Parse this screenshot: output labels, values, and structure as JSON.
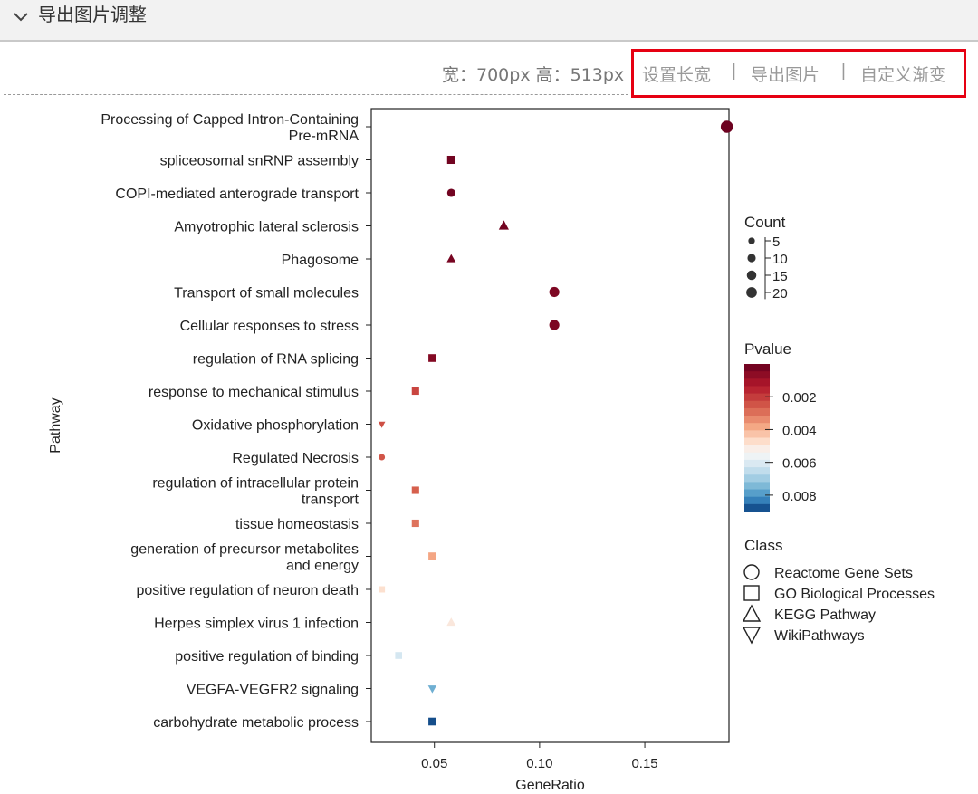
{
  "panel": {
    "title": "导出图片调整"
  },
  "size_info": {
    "text": "宽：700px 高：513px"
  },
  "toolbar": {
    "set_size": "设置长宽",
    "export": "导出图片",
    "gradient": "自定义渐变",
    "separator": "|",
    "highlight_color": "#e60012"
  },
  "chart_data": {
    "type": "scatter",
    "xlabel": "GeneRatio",
    "ylabel": "Pathway",
    "xlim": [
      0.02,
      0.19
    ],
    "xticks": [
      0.05,
      0.1,
      0.15
    ],
    "xtick_labels": [
      "0.05",
      "0.10",
      "0.15"
    ],
    "points": [
      {
        "label": "Processing of Capped Intron-Containing Pre-mRNA",
        "lines": [
          "Processing of Capped Intron-Containing",
          "Pre-mRNA"
        ],
        "x": 0.189,
        "count": 22,
        "pvalue": 0.0001,
        "class": "Reactome Gene Sets"
      },
      {
        "label": "spliceosomal snRNP assembly",
        "lines": [
          "spliceosomal snRNP assembly"
        ],
        "x": 0.058,
        "count": 7,
        "pvalue": 0.0002,
        "class": "GO Biological Processes"
      },
      {
        "label": "COPI-mediated anterograde transport",
        "lines": [
          "COPI-mediated anterograde transport"
        ],
        "x": 0.058,
        "count": 7,
        "pvalue": 0.0002,
        "class": "Reactome Gene Sets"
      },
      {
        "label": "Amyotrophic lateral sclerosis",
        "lines": [
          "Amyotrophic lateral sclerosis"
        ],
        "x": 0.083,
        "count": 10,
        "pvalue": 0.0002,
        "class": "KEGG Pathway"
      },
      {
        "label": "Phagosome",
        "lines": [
          "Phagosome"
        ],
        "x": 0.058,
        "count": 7,
        "pvalue": 0.0003,
        "class": "KEGG Pathway"
      },
      {
        "label": "Transport of small molecules",
        "lines": [
          "Transport of small molecules"
        ],
        "x": 0.107,
        "count": 13,
        "pvalue": 0.0004,
        "class": "Reactome Gene Sets"
      },
      {
        "label": "Cellular responses to stress",
        "lines": [
          "Cellular responses to stress"
        ],
        "x": 0.107,
        "count": 13,
        "pvalue": 0.0004,
        "class": "Reactome Gene Sets"
      },
      {
        "label": "regulation of RNA splicing",
        "lines": [
          "regulation of RNA splicing"
        ],
        "x": 0.049,
        "count": 6,
        "pvalue": 0.0005,
        "class": "GO Biological Processes"
      },
      {
        "label": "response to mechanical stimulus",
        "lines": [
          "response to mechanical stimulus"
        ],
        "x": 0.041,
        "count": 5,
        "pvalue": 0.0022,
        "class": "GO Biological Processes"
      },
      {
        "label": "Oxidative phosphorylation",
        "lines": [
          "Oxidative phosphorylation"
        ],
        "x": 0.025,
        "count": 3,
        "pvalue": 0.0024,
        "class": "WikiPathways"
      },
      {
        "label": "Regulated Necrosis",
        "lines": [
          "Regulated Necrosis"
        ],
        "x": 0.025,
        "count": 3,
        "pvalue": 0.0025,
        "class": "Reactome Gene Sets"
      },
      {
        "label": "regulation of intracellular protein transport",
        "lines": [
          "regulation of intracellular protein",
          "transport"
        ],
        "x": 0.041,
        "count": 5,
        "pvalue": 0.0027,
        "class": "GO Biological Processes"
      },
      {
        "label": "tissue homeostasis",
        "lines": [
          "tissue homeostasis"
        ],
        "x": 0.041,
        "count": 5,
        "pvalue": 0.003,
        "class": "GO Biological Processes"
      },
      {
        "label": "generation of precursor metabolites and energy",
        "lines": [
          "generation of precursor metabolites",
          "and energy"
        ],
        "x": 0.049,
        "count": 6,
        "pvalue": 0.0038,
        "class": "GO Biological Processes"
      },
      {
        "label": "positive regulation of neuron death",
        "lines": [
          "positive regulation of neuron death"
        ],
        "x": 0.025,
        "count": 3,
        "pvalue": 0.0048,
        "class": "GO Biological Processes"
      },
      {
        "label": "Herpes simplex virus 1 infection",
        "lines": [
          "Herpes simplex virus 1 infection"
        ],
        "x": 0.058,
        "count": 7,
        "pvalue": 0.005,
        "class": "KEGG Pathway"
      },
      {
        "label": "positive regulation of binding",
        "lines": [
          "positive regulation of binding"
        ],
        "x": 0.033,
        "count": 4,
        "pvalue": 0.0062,
        "class": "GO Biological Processes"
      },
      {
        "label": "VEGFA-VEGFR2 signaling",
        "lines": [
          "VEGFA-VEGFR2 signaling"
        ],
        "x": 0.049,
        "count": 6,
        "pvalue": 0.0076,
        "class": "WikiPathways"
      },
      {
        "label": "carbohydrate metabolic process",
        "lines": [
          "carbohydrate metabolic process"
        ],
        "x": 0.049,
        "count": 6,
        "pvalue": 0.0088,
        "class": "GO Biological Processes"
      }
    ],
    "legend_count": {
      "title": "Count",
      "values": [
        5,
        10,
        15,
        20
      ]
    },
    "legend_pvalue": {
      "title": "Pvalue",
      "ticks": [
        0.002,
        0.004,
        0.006,
        0.008
      ],
      "tick_labels": [
        "0.002",
        "0.004",
        "0.006",
        "0.008"
      ],
      "range": [
        0.0,
        0.009
      ]
    },
    "legend_class": {
      "title": "Class",
      "items": [
        {
          "name": "Reactome Gene Sets",
          "shape": "circle"
        },
        {
          "name": "GO Biological Processes",
          "shape": "square"
        },
        {
          "name": "KEGG Pathway",
          "shape": "triangle-up"
        },
        {
          "name": "WikiPathways",
          "shape": "triangle-down"
        }
      ]
    },
    "colors": {
      "high": "#67001f",
      "mid": "#f7f7f7",
      "low": "#053061"
    },
    "legend_placement": "right",
    "grid": false
  }
}
